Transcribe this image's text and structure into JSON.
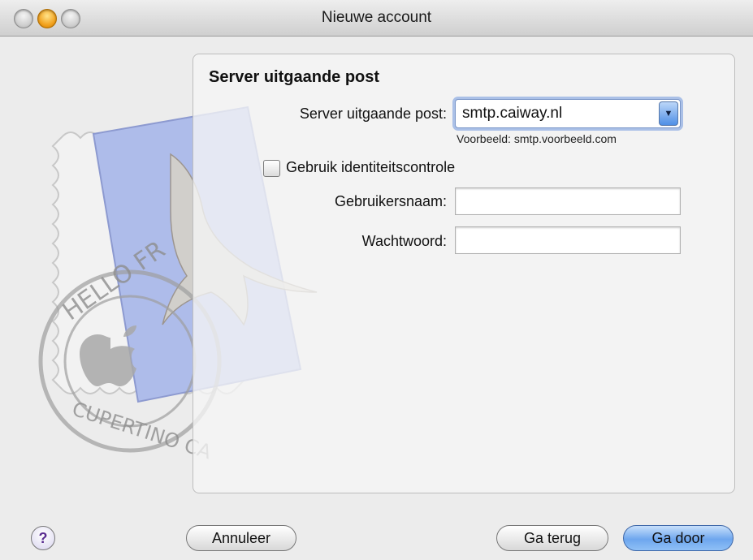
{
  "window": {
    "title": "Nieuwe account"
  },
  "stamp": {
    "text_top": "HELLO FR",
    "text_bottom": "CUPERTINO CA"
  },
  "panel": {
    "heading": "Server uitgaande post",
    "server_label": "Server uitgaande post:",
    "server_value": "smtp.caiway.nl",
    "example_hint": "Voorbeeld: smtp.voorbeeld.com",
    "auth_checkbox_label": "Gebruik identiteitscontrole",
    "auth_checked": false,
    "username_label": "Gebruikersnaam:",
    "username_value": "",
    "password_label": "Wachtwoord:",
    "password_value": ""
  },
  "buttons": {
    "help": "?",
    "cancel": "Annuleer",
    "back": "Ga terug",
    "continue": "Ga door"
  },
  "icons": {
    "dropdown": "chevron-down-icon",
    "help": "question-icon"
  }
}
